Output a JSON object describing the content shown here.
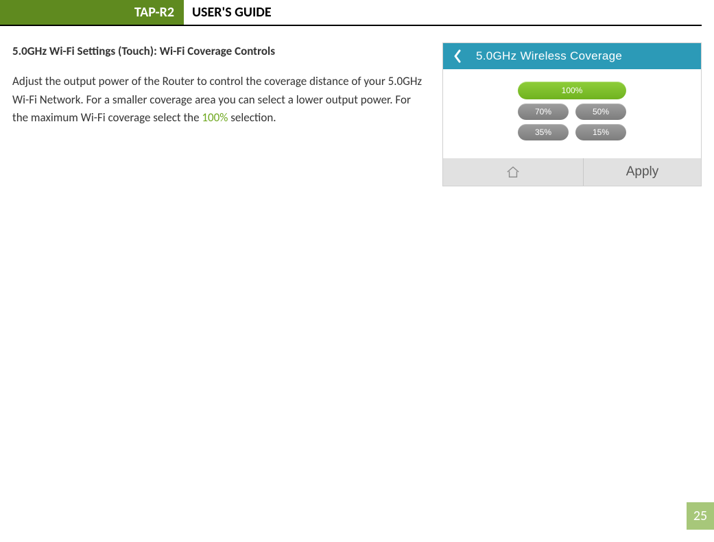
{
  "header": {
    "badge": "TAP-R2",
    "title": "USER'S GUIDE"
  },
  "section": {
    "heading": "5.0GHz Wi-Fi Settings (Touch): Wi-Fi Coverage Controls",
    "body_pre": "Adjust the output power of the Router to control the coverage distance of your 5.0GHz Wi-Fi Network. For a smaller coverage area you can select a lower output power. For the maximum Wi-Fi coverage select the ",
    "body_highlight": "100%",
    "body_post": " selection."
  },
  "device": {
    "title": "5.0GHz Wireless Coverage",
    "options": {
      "selected": "100%",
      "row2a": "70%",
      "row2b": "50%",
      "row3a": "35%",
      "row3b": "15%"
    },
    "apply": "Apply"
  },
  "page_number": "25"
}
